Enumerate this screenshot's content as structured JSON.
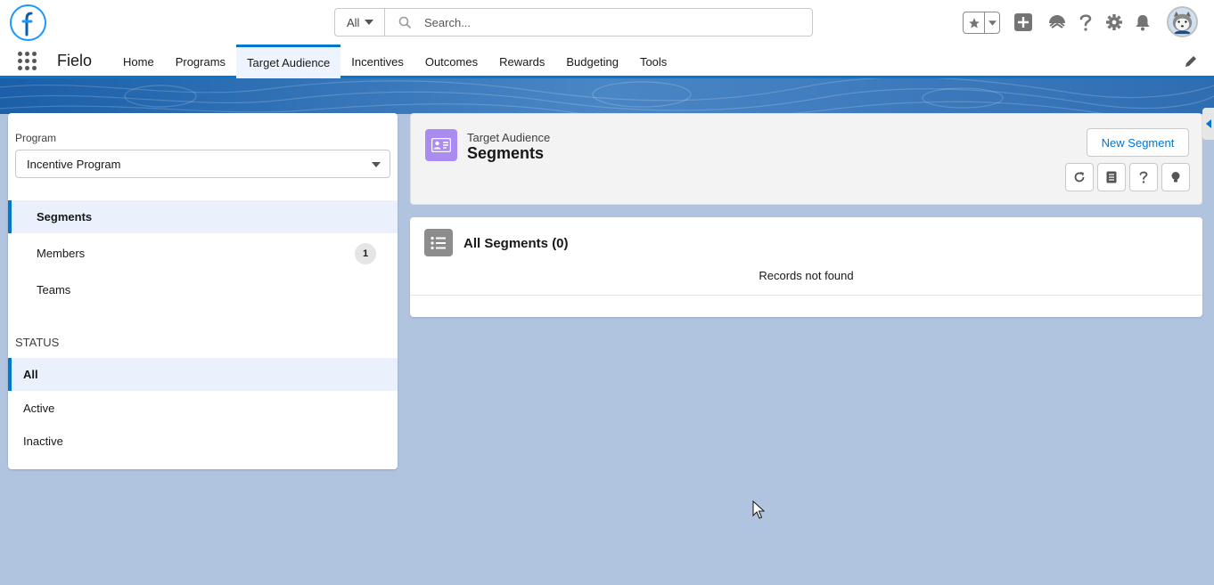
{
  "header": {
    "search_scope": "All",
    "search_placeholder": "Search...",
    "icons": [
      "favorites-star-icon",
      "add-icon",
      "trailhead-icon",
      "help-icon",
      "setup-gear-icon",
      "notification-bell-icon",
      "user-avatar"
    ]
  },
  "nav": {
    "app_name": "Fielo",
    "items": [
      {
        "label": "Home"
      },
      {
        "label": "Programs"
      },
      {
        "label": "Target Audience",
        "active": true
      },
      {
        "label": "Incentives"
      },
      {
        "label": "Outcomes"
      },
      {
        "label": "Rewards"
      },
      {
        "label": "Budgeting"
      },
      {
        "label": "Tools"
      }
    ]
  },
  "sidebar": {
    "program_label": "Program",
    "program_value": "Incentive Program",
    "items": [
      {
        "label": "Segments",
        "active": true
      },
      {
        "label": "Members",
        "count": "1"
      },
      {
        "label": "Teams"
      }
    ],
    "status_heading": "STATUS",
    "status_items": [
      {
        "label": "All",
        "active": true
      },
      {
        "label": "Active"
      },
      {
        "label": "Inactive"
      }
    ]
  },
  "page_header": {
    "eyebrow": "Target Audience",
    "title": "Segments",
    "new_button": "New Segment",
    "icon_buttons": [
      "refresh-icon",
      "list-view-icon",
      "help-icon",
      "lightbulb-icon"
    ]
  },
  "list": {
    "title": "All Segments (0)",
    "empty_message": "Records not found"
  },
  "colors": {
    "brand_blue": "#0176d3",
    "page_bg": "#b0c4df",
    "segment_icon": "#aa8cf0"
  }
}
